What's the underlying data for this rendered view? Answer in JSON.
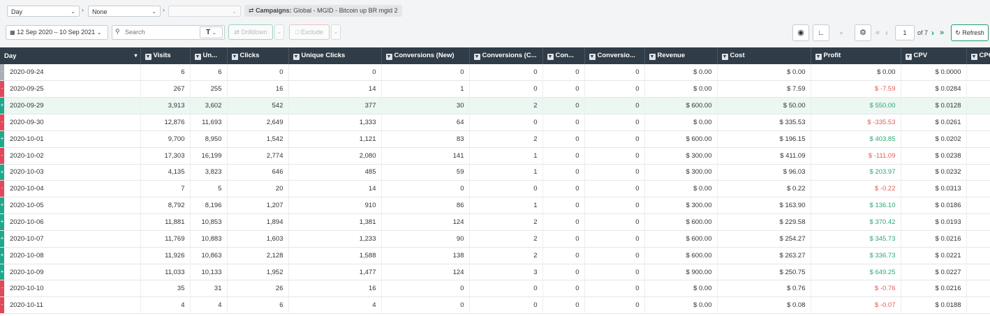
{
  "toolbar": {
    "groupby": [
      "Day",
      "None",
      ""
    ],
    "campaign_prefix": "Campaigns:",
    "campaign_value": "Global - MGID - Bitcoin up BR mgid 2",
    "date_range": "12 Sep 2020 – 10 Sep 2021",
    "search_placeholder": "Search",
    "text_toggle": "T",
    "drilldown_label": "Drilldown",
    "exclude_label": "Exclude",
    "page_current": "1",
    "page_of": "of 7",
    "refresh_label": "Refresh"
  },
  "colors": {
    "header_bg": "#303c47",
    "positive": "#2aa872",
    "negative": "#e05c5c",
    "indicator_up": "#1fa88c",
    "indicator_down": "#e0495a",
    "indicator_neutral": "#aab0b6",
    "highlight_row": "#ecf7f2"
  },
  "table": {
    "columns": [
      "Day",
      "Visits",
      "Un...",
      "Clicks",
      "Unique Clicks",
      "Conversions (New)",
      "Conversions (C...",
      "Con...",
      "Conversio...",
      "Revenue",
      "Cost",
      "Profit",
      "CPV",
      "CPC"
    ],
    "rows": [
      {
        "trend": "neutral",
        "profit_sign": "zero",
        "cells": [
          "2020-09-24",
          "6",
          "6",
          "0",
          "0",
          "0",
          "0",
          "0",
          "0",
          "$ 0.00",
          "$ 0.00",
          "$ 0.00",
          "$ 0.0000",
          ""
        ]
      },
      {
        "trend": "down",
        "profit_sign": "neg",
        "cells": [
          "2020-09-25",
          "267",
          "255",
          "16",
          "14",
          "1",
          "0",
          "0",
          "0",
          "$ 0.00",
          "$ 7.59",
          "$ -7.59",
          "$ 0.0284",
          ""
        ]
      },
      {
        "trend": "up",
        "profit_sign": "pos",
        "highlight": true,
        "cells": [
          "2020-09-29",
          "3,913",
          "3,602",
          "542",
          "377",
          "30",
          "2",
          "0",
          "0",
          "$ 600.00",
          "$ 50.00",
          "$ 550.00",
          "$ 0.0128",
          ""
        ]
      },
      {
        "trend": "down",
        "profit_sign": "neg",
        "cells": [
          "2020-09-30",
          "12,876",
          "11,693",
          "2,649",
          "1,333",
          "64",
          "0",
          "0",
          "0",
          "$ 0.00",
          "$ 335.53",
          "$ -335.53",
          "$ 0.0261",
          ""
        ]
      },
      {
        "trend": "up",
        "profit_sign": "pos",
        "cells": [
          "2020-10-01",
          "9,700",
          "8,950",
          "1,542",
          "1,121",
          "83",
          "2",
          "0",
          "0",
          "$ 600.00",
          "$ 196.15",
          "$ 403.85",
          "$ 0.0202",
          ""
        ]
      },
      {
        "trend": "down",
        "profit_sign": "neg",
        "cells": [
          "2020-10-02",
          "17,303",
          "16,199",
          "2,774",
          "2,080",
          "141",
          "1",
          "0",
          "0",
          "$ 300.00",
          "$ 411.09",
          "$ -111.09",
          "$ 0.0238",
          ""
        ]
      },
      {
        "trend": "up",
        "profit_sign": "pos",
        "cells": [
          "2020-10-03",
          "4,135",
          "3,823",
          "646",
          "485",
          "59",
          "1",
          "0",
          "0",
          "$ 300.00",
          "$ 96.03",
          "$ 203.97",
          "$ 0.0232",
          ""
        ]
      },
      {
        "trend": "down",
        "profit_sign": "neg",
        "cells": [
          "2020-10-04",
          "7",
          "5",
          "20",
          "14",
          "0",
          "0",
          "0",
          "0",
          "$ 0.00",
          "$ 0.22",
          "$ -0.22",
          "$ 0.0313",
          ""
        ]
      },
      {
        "trend": "up",
        "profit_sign": "pos",
        "cells": [
          "2020-10-05",
          "8,792",
          "8,196",
          "1,207",
          "910",
          "86",
          "1",
          "0",
          "0",
          "$ 300.00",
          "$ 163.90",
          "$ 136.10",
          "$ 0.0186",
          ""
        ]
      },
      {
        "trend": "up",
        "profit_sign": "pos",
        "cells": [
          "2020-10-06",
          "11,881",
          "10,853",
          "1,894",
          "1,381",
          "124",
          "2",
          "0",
          "0",
          "$ 600.00",
          "$ 229.58",
          "$ 370.42",
          "$ 0.0193",
          ""
        ]
      },
      {
        "trend": "up",
        "profit_sign": "pos",
        "cells": [
          "2020-10-07",
          "11,769",
          "10,883",
          "1,603",
          "1,233",
          "90",
          "2",
          "0",
          "0",
          "$ 600.00",
          "$ 254.27",
          "$ 345.73",
          "$ 0.0216",
          ""
        ]
      },
      {
        "trend": "up",
        "profit_sign": "pos",
        "cells": [
          "2020-10-08",
          "11,926",
          "10,863",
          "2,128",
          "1,588",
          "138",
          "2",
          "0",
          "0",
          "$ 600.00",
          "$ 263.27",
          "$ 336.73",
          "$ 0.0221",
          ""
        ]
      },
      {
        "trend": "up",
        "profit_sign": "pos",
        "cells": [
          "2020-10-09",
          "11,033",
          "10,133",
          "1,952",
          "1,477",
          "124",
          "3",
          "0",
          "0",
          "$ 900.00",
          "$ 250.75",
          "$ 649.25",
          "$ 0.0227",
          ""
        ]
      },
      {
        "trend": "down",
        "profit_sign": "neg",
        "cells": [
          "2020-10-10",
          "35",
          "31",
          "26",
          "16",
          "0",
          "0",
          "0",
          "0",
          "$ 0.00",
          "$ 0.76",
          "$ -0.76",
          "$ 0.0216",
          ""
        ]
      },
      {
        "trend": "down",
        "profit_sign": "neg",
        "cells": [
          "2020-10-11",
          "4",
          "4",
          "6",
          "4",
          "0",
          "0",
          "0",
          "0",
          "$ 0.00",
          "$ 0.08",
          "$ -0.07",
          "$ 0.0188",
          ""
        ]
      }
    ]
  }
}
